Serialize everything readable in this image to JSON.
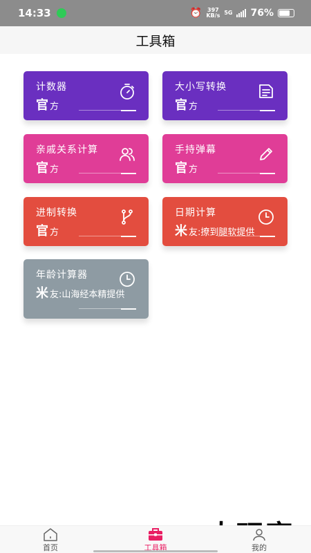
{
  "status_bar": {
    "time": "14:33",
    "net_speed_value": "397",
    "net_speed_unit": "KB/s",
    "network_type": "5G",
    "battery_percent": "76%"
  },
  "header": {
    "title": "工具箱"
  },
  "colors": {
    "purple": "#6a2fc0",
    "pink": "#e03d97",
    "red": "#e34d3f",
    "gray": "#8e9ba3",
    "active_tab": "#e91e63"
  },
  "cards": [
    {
      "title": "计数器",
      "sub_big": "官",
      "sub_rest": "方",
      "icon": "stopwatch-icon"
    },
    {
      "title": "大小写转换",
      "sub_big": "官",
      "sub_rest": "方",
      "icon": "document-icon"
    },
    {
      "title": "亲戚关系计算",
      "sub_big": "官",
      "sub_rest": "方",
      "icon": "users-icon"
    },
    {
      "title": "手持弹幕",
      "sub_big": "官",
      "sub_rest": "方",
      "icon": "pencil-icon"
    },
    {
      "title": "进制转换",
      "sub_big": "官",
      "sub_rest": "方",
      "icon": "branch-icon"
    },
    {
      "title": "日期计算",
      "sub_big": "米",
      "sub_rest": "友:撩到腿软提供",
      "icon": "clock-icon"
    },
    {
      "title": "年龄计算器",
      "sub_big": "米",
      "sub_rest": "友:山海经本精提供",
      "icon": "clock-icon"
    }
  ],
  "bottom_nav": {
    "items": [
      {
        "label": "首页",
        "icon": "home-icon"
      },
      {
        "label": "工具箱",
        "icon": "toolbox-icon"
      },
      {
        "label": "我的",
        "icon": "profile-icon"
      }
    ],
    "active_index": 1
  },
  "watermark": "大玩客"
}
